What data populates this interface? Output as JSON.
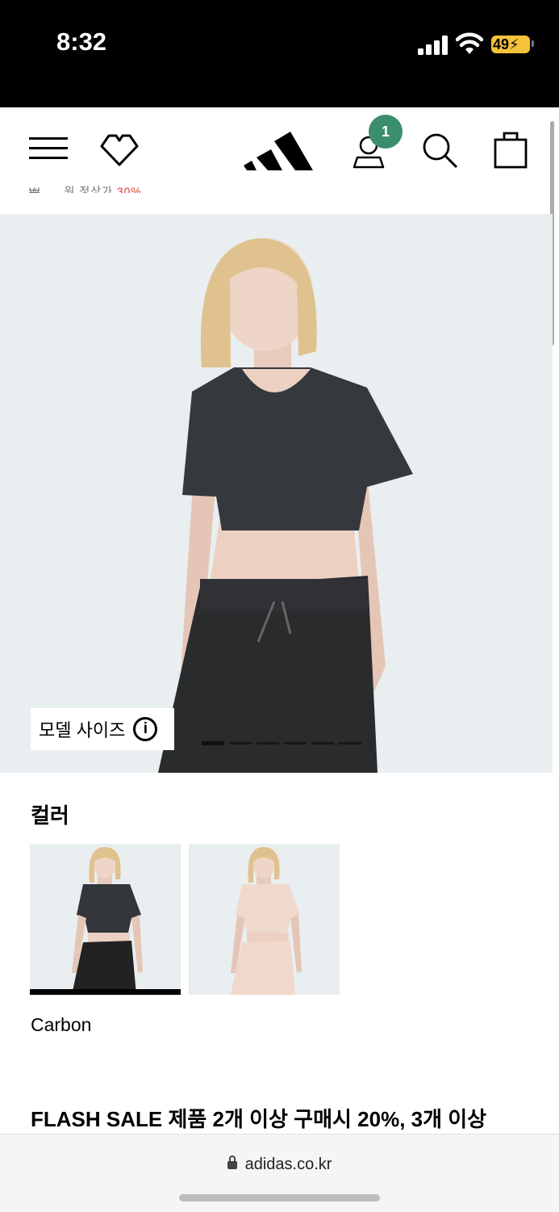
{
  "status_bar": {
    "time": "8:32",
    "battery": "49"
  },
  "nav": {
    "cart_badge": "1",
    "partial_text": "₩,,,,, 원 정상가 ",
    "partial_sale": "30%"
  },
  "hero": {
    "model_size_label": "모델 사이즈",
    "info_icon": "i",
    "pager_total": 6,
    "pager_active": 1
  },
  "color": {
    "heading": "컬러",
    "selected_name": "Carbon",
    "swatches": [
      "carbon",
      "pink"
    ]
  },
  "promo": {
    "text": "FLASH SALE 제품 2개 이상 구매시 20%, 3개 이상"
  },
  "browser": {
    "url": "adidas.co.kr"
  },
  "colors": {
    "badge": "#3b8e6c",
    "hero_bg": "#e9eef0",
    "sale": "#e0362c"
  }
}
